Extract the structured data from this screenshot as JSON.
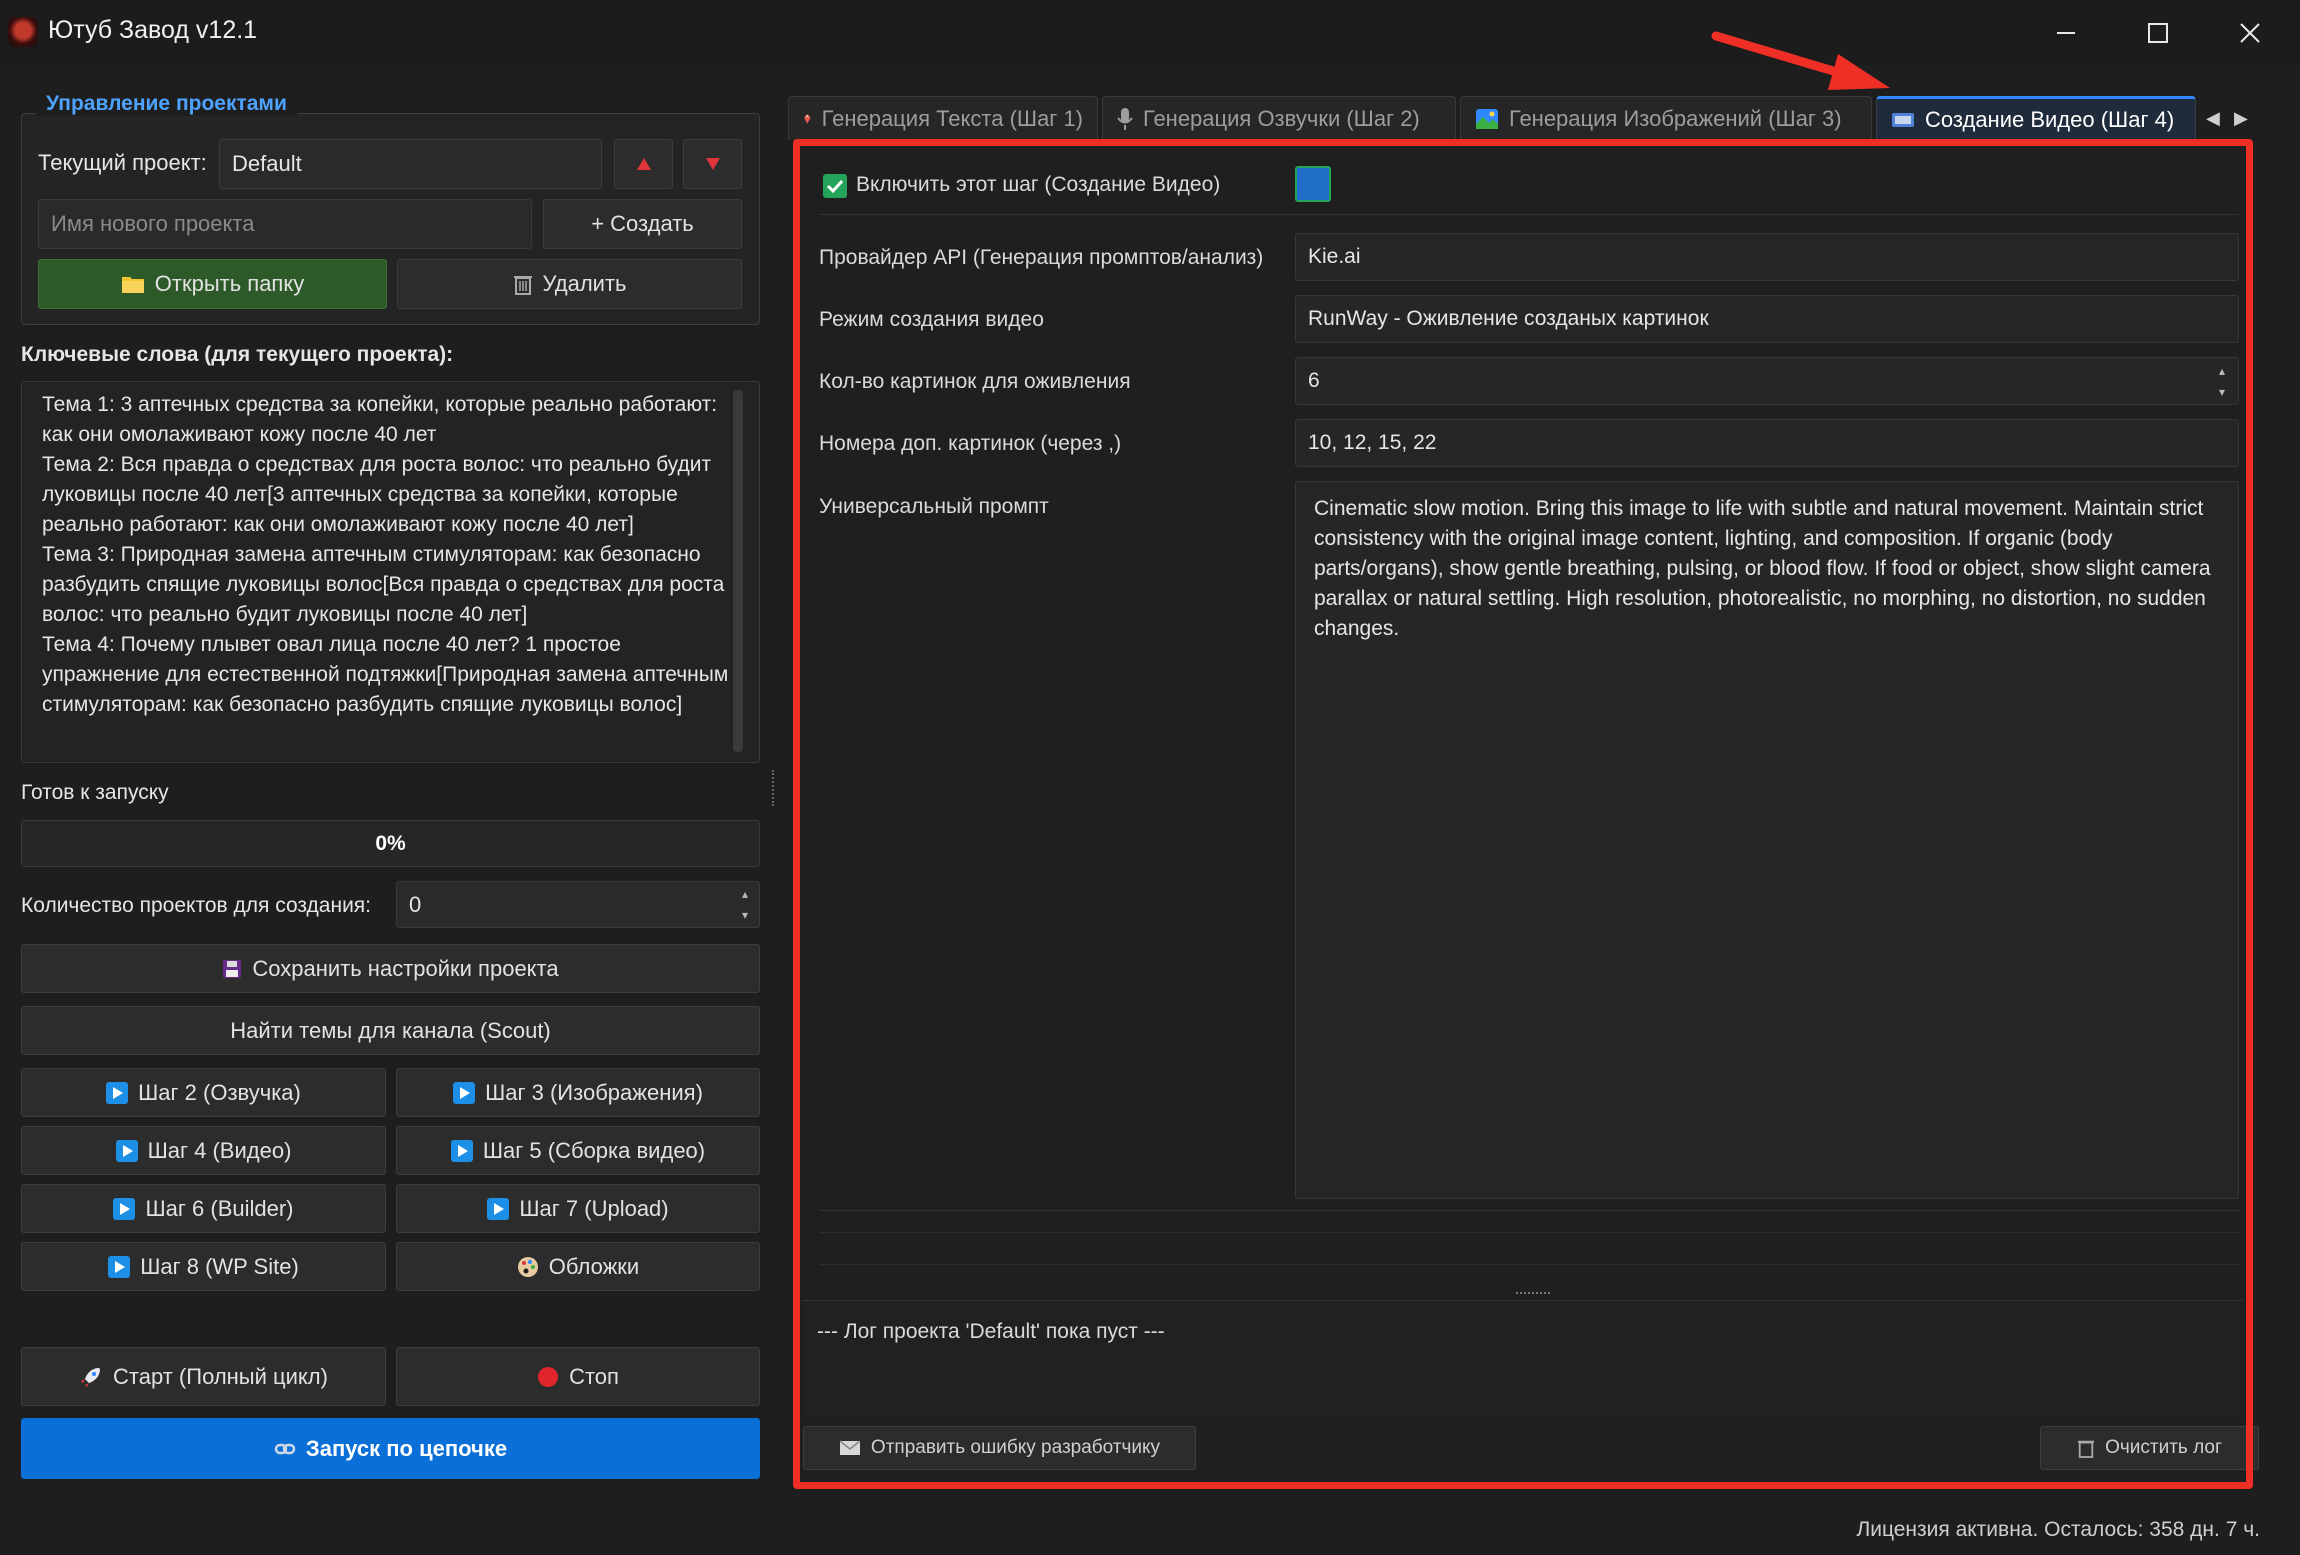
{
  "window": {
    "title": "Ютуб Завод v12.1",
    "controls": {
      "minimize": "minimize-icon",
      "maximize": "maximize-icon",
      "close": "close-icon"
    }
  },
  "project_mgmt": {
    "group_title": "Управление проектами",
    "current_label": "Текущий проект:",
    "current_value": "Default",
    "new_name_placeholder": "Имя нового проекта",
    "create_label": "+ Создать",
    "open_folder_label": "Открыть папку",
    "delete_label": "Удалить"
  },
  "keywords": {
    "title": "Ключевые слова (для текущего проекта):",
    "text": "Тема 1: 3 аптечных средства за копейки, которые реально работают: как они омолаживают кожу после 40 лет\nТема 2: Вся правда о средствах для роста волос: что реально будит луковицы после 40 лет[3 аптечных средства за копейки, которые реально работают: как они омолаживают кожу после 40 лет]\nТема 3: Природная замена аптечным стимуляторам: как безопасно разбудить спящие луковицы волос[Вся правда о средствах для роста волос: что реально будит луковицы после 40 лет]\nТема 4: Почему плывет овал лица после 40 лет? 1 простое упражнение для естественной подтяжки[Природная замена аптечным стимуляторам: как безопасно разбудить спящие луковицы волос]"
  },
  "status": {
    "ready_text": "Готов к запуску",
    "progress": 0,
    "progress_label": "0%"
  },
  "project_count": {
    "label": "Количество проектов для создания:",
    "value": "0"
  },
  "buttons": {
    "save_settings": "Сохранить настройки проекта",
    "find_topics": "Найти темы для канала (Scout)",
    "step2": "Шаг 2 (Озвучка)",
    "step3": "Шаг 3 (Изображения)",
    "step4": "Шаг 4 (Видео)",
    "step5": "Шаг 5 (Сборка видео)",
    "step6": "Шаг 6 (Builder)",
    "step7": "Шаг 7 (Upload)",
    "step8": "Шаг 8 (WP Site)",
    "covers": "Обложки",
    "start": "Старт (Полный цикл)",
    "stop": "Стоп",
    "chain": "Запуск по цепочке"
  },
  "tabs": [
    {
      "label": "Генерация Текста (Шаг 1)",
      "icon": "text-icon",
      "active": false
    },
    {
      "label": "Генерация Озвучки (Шаг 2)",
      "icon": "microphone-icon",
      "active": false
    },
    {
      "label": "Генерация Изображений (Шаг 3)",
      "icon": "picture-icon",
      "active": false
    },
    {
      "label": "Создание Видео (Шаг 4)",
      "icon": "film-icon",
      "active": true
    }
  ],
  "step4": {
    "enable_label": "Включить этот шаг (Создание Видео)",
    "enabled": true,
    "color_swatch": "#1f6fc8",
    "provider_label": "Провайдер API (Генерация промптов/анализ)",
    "provider_value": "Kie.ai",
    "mode_label": "Режим создания видео",
    "mode_value": "RunWay - Оживление созданых картинок",
    "count_label": "Кол-во картинок для оживления",
    "count_value": "6",
    "extra_label": "Номера доп. картинок (через ,)",
    "extra_value": "10, 12, 15, 22",
    "prompt_label": "Универсальный промпт",
    "prompt_value": "Cinematic slow motion. Bring this image to life with subtle and natural movement. Maintain strict consistency with the original image content, lighting, and composition. If organic (body parts/organs), show gentle breathing, pulsing, or blood flow. If food or object, show slight camera parallax or natural settling. High resolution, photorealistic, no morphing, no distortion, no sudden changes."
  },
  "log": {
    "text": "--- Лог проекта 'Default' пока пуст ---",
    "send_error_label": "Отправить ошибку разработчику",
    "clear_label": "Очистить лог"
  },
  "statusbar": {
    "license_text": "Лицензия активна. Осталось: 358 дн. 7 ч."
  },
  "colors": {
    "accent_blue": "#0a6fd6",
    "highlight_red": "#ef2f26",
    "green_button": "#2e5a2a"
  }
}
